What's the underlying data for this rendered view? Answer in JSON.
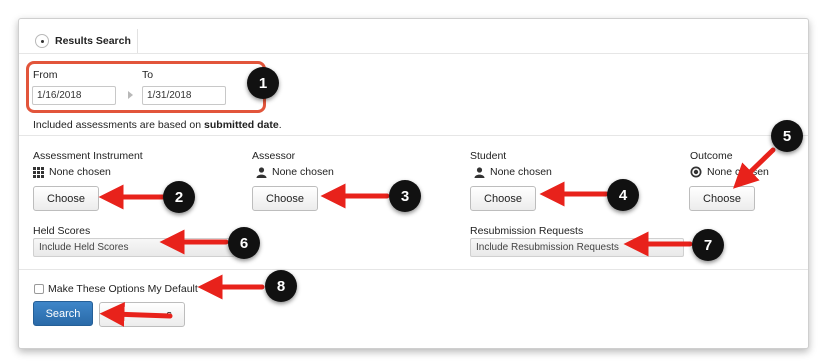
{
  "search_tab": {
    "label": "Results Search"
  },
  "date_range": {
    "from_label": "From",
    "from_value": "1/16/2018",
    "to_label": "To",
    "to_value": "1/31/2018"
  },
  "note": {
    "text_prefix": "Included assessments are based on ",
    "text_bold": "submitted date",
    "text_suffix": "."
  },
  "filters": {
    "assessment_instrument": {
      "label": "Assessment Instrument",
      "value": "None chosen",
      "button": "Choose",
      "icon": "grid-icon"
    },
    "assessor": {
      "label": "Assessor",
      "value": "None chosen",
      "button": "Choose",
      "icon": "person-icon"
    },
    "student": {
      "label": "Student",
      "value": "None chosen",
      "button": "Choose",
      "icon": "person-icon"
    },
    "outcome": {
      "label": "Outcome",
      "value": "None chosen",
      "button": "Choose",
      "icon": "target-icon"
    }
  },
  "held_scores": {
    "label": "Held Scores",
    "selected": "Include Held Scores"
  },
  "resubmission": {
    "label": "Resubmission Requests",
    "selected": "Include Resubmission Requests"
  },
  "default_option": {
    "label": "Make These Options My Default",
    "checked": false
  },
  "actions": {
    "search_label": "Search",
    "second_label_visible": "s"
  },
  "callouts": [
    "1",
    "2",
    "3",
    "4",
    "5",
    "6",
    "7",
    "8"
  ],
  "colors": {
    "highlight": "#e2553b",
    "arrow": "#e8221b",
    "primary": "#2f74b5",
    "badge": "#111111"
  }
}
